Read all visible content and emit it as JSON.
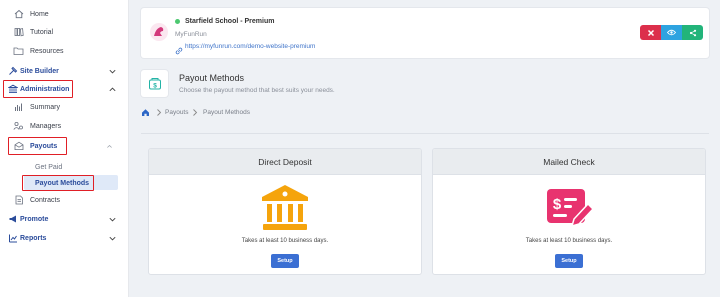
{
  "sidebar": {
    "items": {
      "home": "Home",
      "tutorial": "Tutorial",
      "resources": "Resources",
      "site_builder": "Site Builder",
      "administration": "Administration",
      "summary": "Summary",
      "managers": "Managers",
      "payouts": "Payouts",
      "get_paid": "Get Paid",
      "payout_methods": "Payout Methods",
      "contracts": "Contracts",
      "promote": "Promote",
      "reports": "Reports"
    },
    "highlight_color": "#e01f26",
    "active_color": "#2b4c9b"
  },
  "header": {
    "school_name": "Starfield School - Premium",
    "subtitle": "MyFunRun",
    "url": "https://myfunrun.com/demo-website-premium",
    "status_color": "#4cc870",
    "buttons": {
      "tool_icon": "tools-icon",
      "view_icon": "eye-icon",
      "share_icon": "share-icon"
    }
  },
  "page": {
    "title": "Payout Methods",
    "subtitle": "Choose the payout method that best suits your needs."
  },
  "breadcrumb": {
    "home_icon": "home-icon",
    "items": [
      "Payouts",
      "Payout Methods"
    ]
  },
  "cards": [
    {
      "title": "Direct Deposit",
      "icon": "bank-icon",
      "icon_color": "#f5a40c",
      "description": "Takes at least 10 business days.",
      "button": "Setup"
    },
    {
      "title": "Mailed Check",
      "icon": "check-icon",
      "icon_color": "#e8336f",
      "description": "Takes at least 10 business days.",
      "button": "Setup"
    }
  ]
}
